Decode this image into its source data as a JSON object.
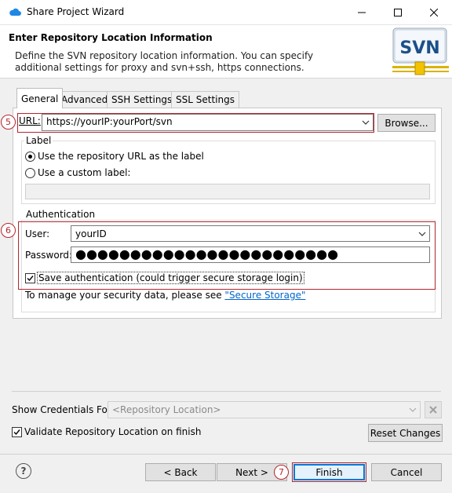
{
  "window": {
    "title": "Share Project Wizard",
    "controls": {
      "minimize": "—",
      "maximize": "☐",
      "close": "✕"
    }
  },
  "banner": {
    "title": "Enter Repository Location Information",
    "description_line1": "Define the SVN repository location information. You can specify",
    "description_line2": "additional settings for proxy and svn+ssh, https connections.",
    "logo_text": "SVN"
  },
  "tabs": [
    {
      "label": "General",
      "active": true
    },
    {
      "label": "Advanced",
      "active": false
    },
    {
      "label": "SSH Settings",
      "active": false
    },
    {
      "label": "SSL Settings",
      "active": false
    }
  ],
  "url": {
    "label": "URL:",
    "value": "https://yourIP:yourPort/svn",
    "browse_label": "Browse..."
  },
  "label_group": {
    "title": "Label",
    "option_repo_url": "Use the repository URL as the label",
    "option_custom": "Use a custom label:",
    "selected": "repository_url",
    "custom_value": ""
  },
  "auth_group": {
    "title": "Authentication",
    "user_label": "User:",
    "user_value": "yourID",
    "password_label": "Password:",
    "password_masked": "●●●●●●●●●●●●●●●●●●●●●●●●",
    "save_auth_label": "Save authentication (could trigger secure storage login)",
    "save_auth_checked": true,
    "manage_text": "To manage your security data, please see ",
    "manage_link": "\"Secure Storage\""
  },
  "credentials": {
    "label": "Show Credentials For:",
    "placeholder": "<Repository Location>"
  },
  "validate": {
    "label": "Validate Repository Location on finish",
    "checked": true,
    "reset_label": "Reset Changes"
  },
  "footer": {
    "help": "?",
    "back": "< Back",
    "next": "Next >",
    "finish": "Finish",
    "cancel": "Cancel"
  },
  "annotations": [
    "5",
    "6",
    "7"
  ],
  "colors": {
    "annotation_red": "#b3262e",
    "link_blue": "#0066cc",
    "focus_blue": "#0078d7"
  }
}
